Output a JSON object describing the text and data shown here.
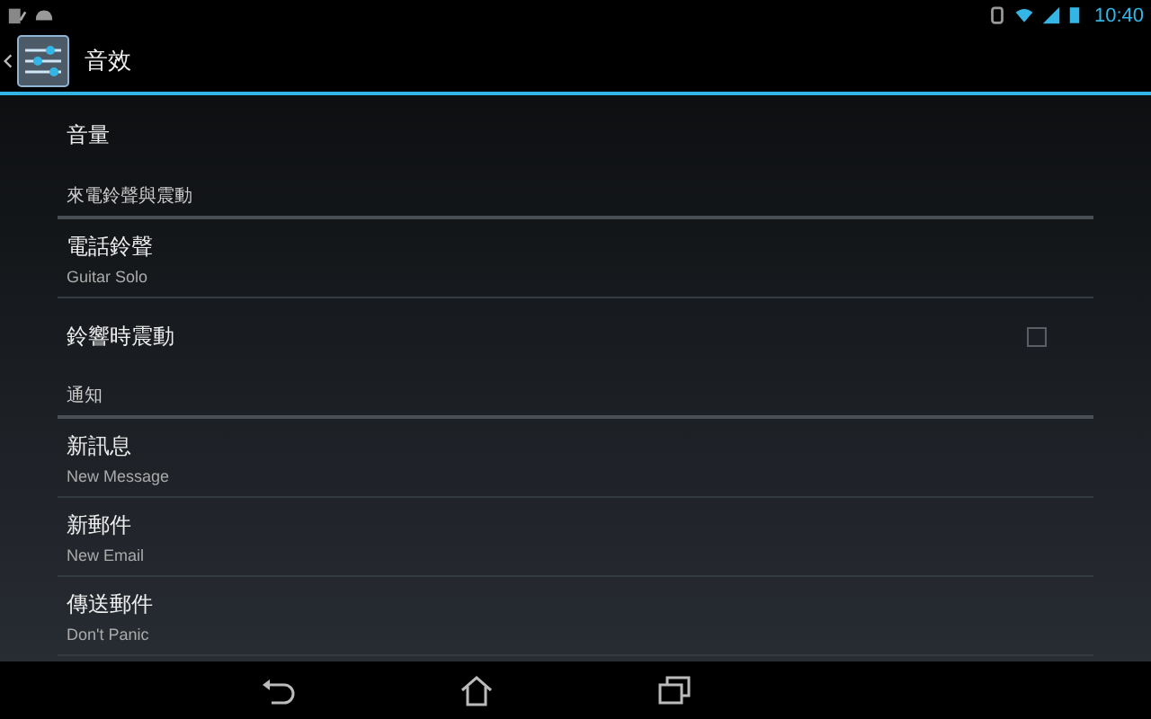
{
  "status_bar": {
    "time": "10:40"
  },
  "action_bar": {
    "title": "音效"
  },
  "settings": [
    {
      "kind": "item",
      "title": "音量"
    },
    {
      "kind": "header",
      "title": "來電鈴聲與震動"
    },
    {
      "kind": "item",
      "title": "電話鈴聲",
      "summary": "Guitar Solo"
    },
    {
      "kind": "checkbox",
      "title": "鈴響時震動",
      "checked": false
    },
    {
      "kind": "header",
      "title": "通知"
    },
    {
      "kind": "item",
      "title": "新訊息",
      "summary": "New Message"
    },
    {
      "kind": "item",
      "title": "新郵件",
      "summary": "New Email"
    },
    {
      "kind": "item",
      "title": "傳送郵件",
      "summary": "Don't Panic"
    }
  ]
}
